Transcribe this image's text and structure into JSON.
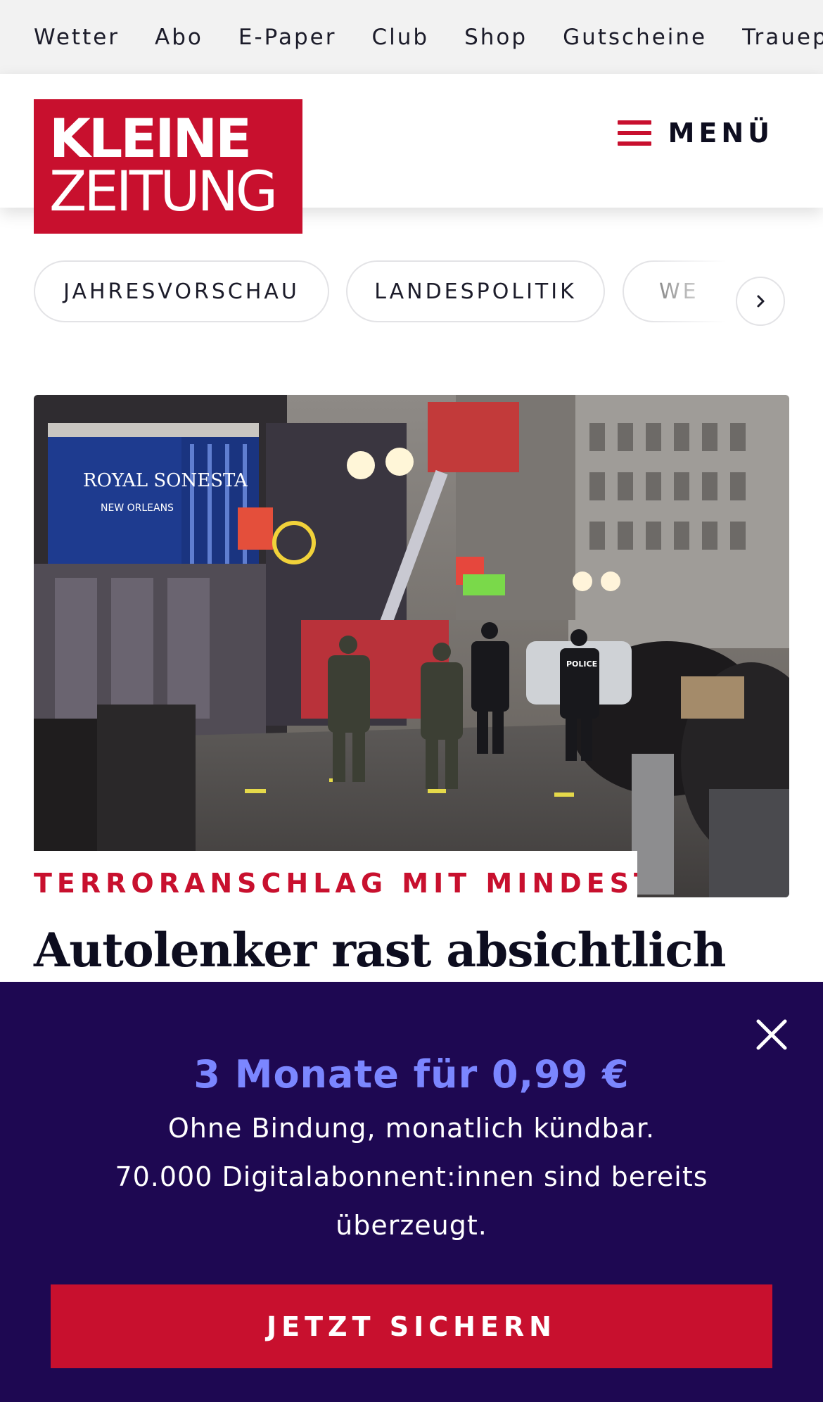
{
  "topnav": {
    "items": [
      "Wetter",
      "Abo",
      "E-Paper",
      "Club",
      "Shop",
      "Gutscheine",
      "Traueportal"
    ]
  },
  "header": {
    "logo_line1": "KLEINE",
    "logo_line2": "ZEITUNG",
    "menu_label": "MENÜ",
    "icons": {
      "menu": "hamburger-icon"
    }
  },
  "chips": {
    "items": [
      "JAHRESVORSCHAU",
      "LANDESPOLITIK",
      "WE"
    ],
    "next_icon": "chevron-right-icon"
  },
  "article": {
    "kicker": "TERRORANSCHLAG MIT MINDESTEN…",
    "headline": "Autolenker rast absichtlich",
    "image_signage": [
      "ROYAL SONESTA",
      "NEW ORLEANS",
      "POLICE"
    ]
  },
  "promo": {
    "title": "3 Monate für 0,99 €",
    "line1": "Ohne Bindung, monatlich kündbar.",
    "line2": "70.000 Digitalabonnent:innen sind bereits",
    "line3": "überzeugt.",
    "cta": "JETZT SICHERN",
    "close_icon": "close-icon"
  },
  "colors": {
    "brand_red": "#c8102e",
    "promo_bg": "#1e0852",
    "promo_accent": "#7b86ff",
    "topnav_bg": "#f2f2f2"
  }
}
